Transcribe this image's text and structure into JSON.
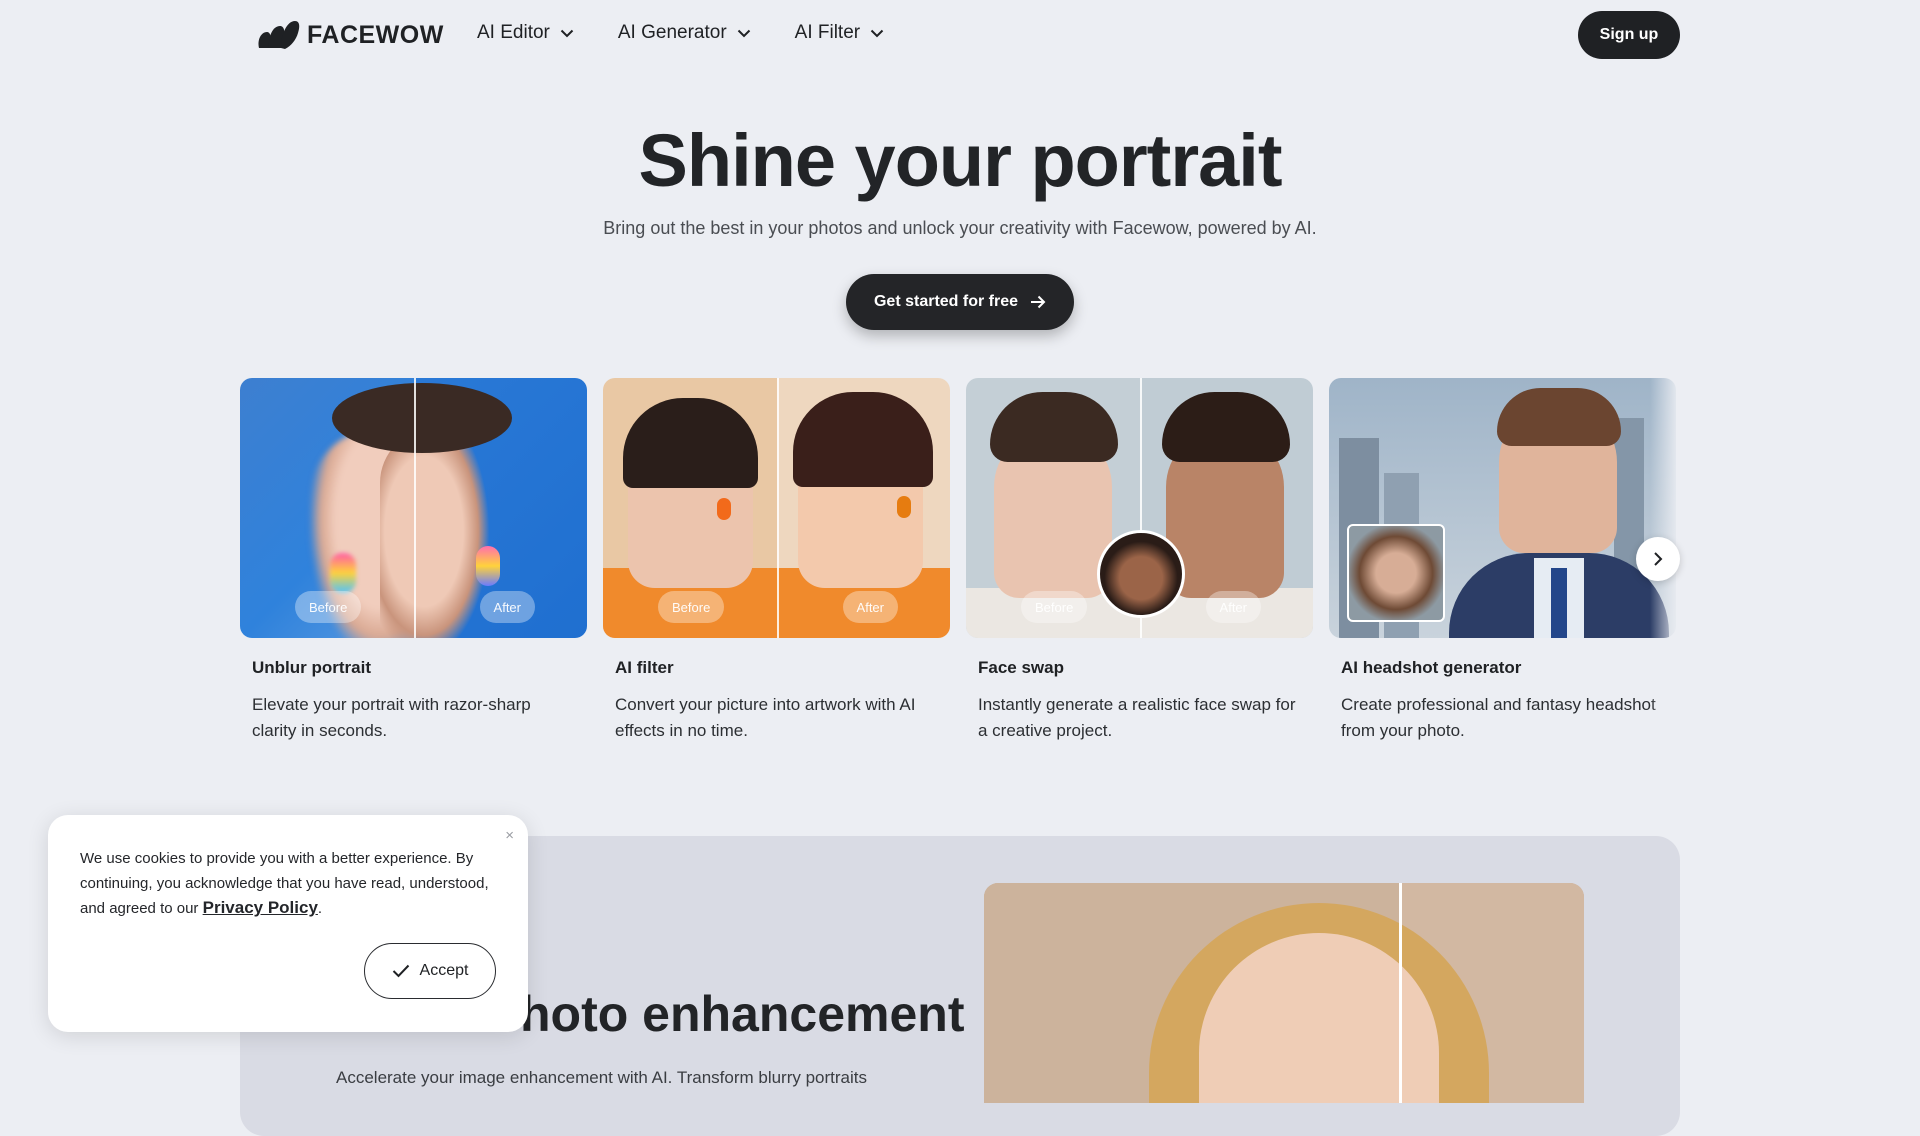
{
  "header": {
    "logo_text": "FACEWOW",
    "nav": [
      {
        "label": "AI Editor"
      },
      {
        "label": "AI Generator"
      },
      {
        "label": "AI Filter"
      }
    ],
    "signup_label": "Sign up"
  },
  "hero": {
    "title": "Shine your portrait",
    "subtitle": "Bring out the best in your photos and unlock your creativity with Facewow, powered by AI.",
    "cta_label": "Get started for free"
  },
  "cards": [
    {
      "title": "Unblur portrait",
      "description": "Elevate your portrait with razor-sharp clarity in seconds.",
      "before": "Before",
      "after": "After"
    },
    {
      "title": "AI filter",
      "description": "Convert your picture into artwork with AI effects in no time.",
      "before": "Before",
      "after": "After"
    },
    {
      "title": "Face swap",
      "description": "Instantly generate a realistic face swap for a creative project.",
      "before": "Before",
      "after": "After"
    },
    {
      "title": "AI headshot generator",
      "description": "Create professional and fantasy headshot from your photo."
    }
  ],
  "lower": {
    "title": "hoto enhancement",
    "description": "Accelerate your image enhancement with AI. Transform blurry portraits"
  },
  "cookie": {
    "text": "We use cookies to provide you with a better experience. By continuing, you acknowledge that you have read, understood, and agreed to our",
    "link_label": "Privacy Policy",
    "period": ".",
    "accept_label": "Accept",
    "close_glyph": "×"
  },
  "colors": {
    "background": "#eceef3",
    "dark_button": "#1f2124"
  }
}
